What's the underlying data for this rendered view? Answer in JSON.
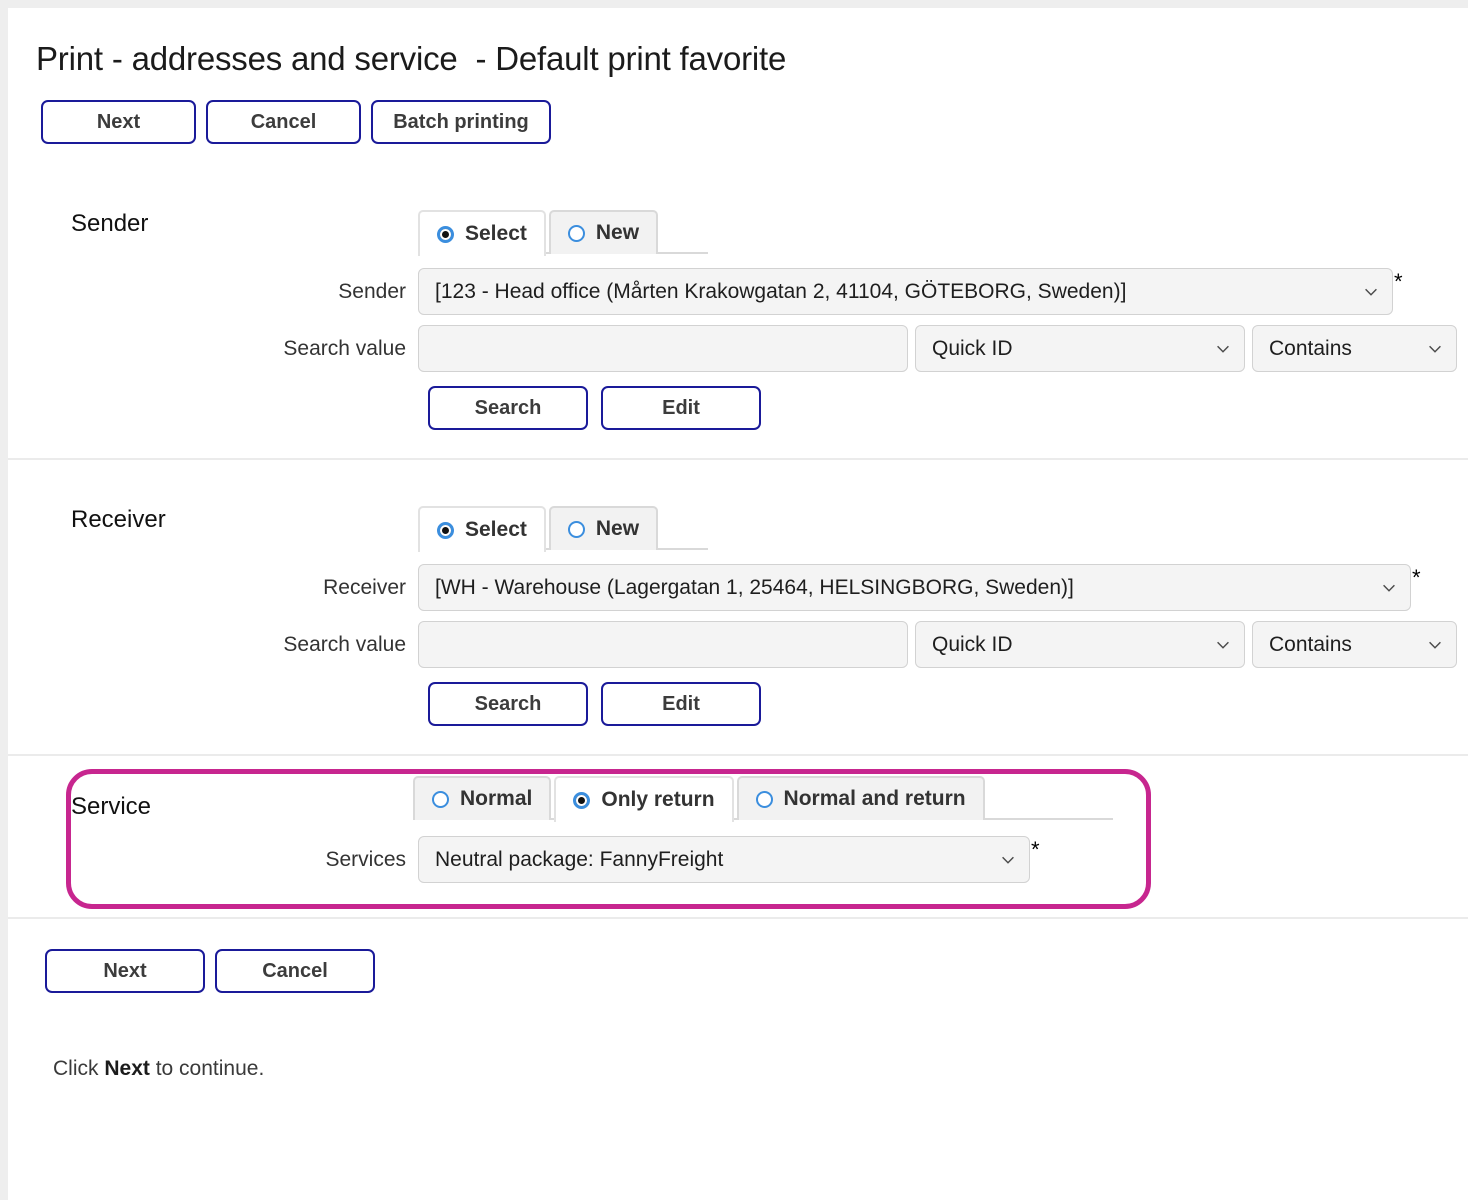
{
  "page": {
    "title": "Print - addresses and service  - Default print favorite",
    "footer_note_prefix": "Click ",
    "footer_note_bold": "Next",
    "footer_note_suffix": " to continue.",
    "required_marker": "*",
    "highlight_color": "#c7268f",
    "button_border_color": "#1a1a99",
    "radio_ring_color": "#3b8ede"
  },
  "toolbar_top": {
    "next_label": "Next",
    "cancel_label": "Cancel",
    "batch_label": "Batch printing"
  },
  "toolbar_bottom": {
    "next_label": "Next",
    "cancel_label": "Cancel"
  },
  "sender": {
    "section_label": "Sender",
    "tabs": [
      {
        "label": "Select",
        "selected": true
      },
      {
        "label": "New",
        "selected": false
      }
    ],
    "sender_field_label": "Sender",
    "sender_value": "[123 - Head office (Mårten Krakowgatan 2, 41104, GÖTEBORG, Sweden)]",
    "search_value_label": "Search value",
    "search_value": "",
    "search_value_placeholder": "",
    "search_field_option": "Quick ID",
    "search_match_option": "Contains",
    "search_button": "Search",
    "edit_button": "Edit"
  },
  "receiver": {
    "section_label": "Receiver",
    "tabs": [
      {
        "label": "Select",
        "selected": true
      },
      {
        "label": "New",
        "selected": false
      }
    ],
    "receiver_field_label": "Receiver",
    "receiver_value": "[WH - Warehouse (Lagergatan 1, 25464, HELSINGBORG, Sweden)]",
    "search_value_label": "Search value",
    "search_value": "",
    "search_value_placeholder": "",
    "search_field_option": "Quick ID",
    "search_match_option": "Contains",
    "search_button": "Search",
    "edit_button": "Edit"
  },
  "service": {
    "section_label": "Service",
    "tabs": [
      {
        "label": "Normal",
        "selected": false
      },
      {
        "label": "Only return",
        "selected": true
      },
      {
        "label": "Normal and return",
        "selected": false
      }
    ],
    "services_field_label": "Services",
    "services_value": "Neutral package: FannyFreight"
  },
  "icons": {
    "chevron_down": "chevron-down-icon"
  }
}
